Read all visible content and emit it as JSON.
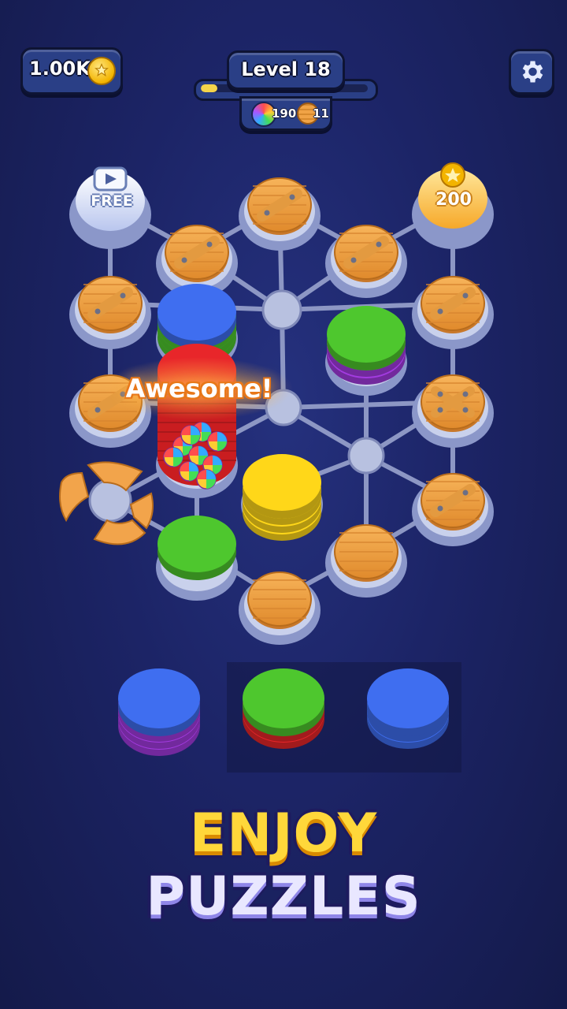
{
  "hud": {
    "coins": "1.00K",
    "level": "Level 18",
    "level_progress": 0.1,
    "rainbow_count": "190",
    "chip_count": "11"
  },
  "board": {
    "free_label": "FREE",
    "unlock_cost": "200",
    "combo_text": "Awesome!"
  },
  "tray": {
    "stacks": [
      {
        "top": "blue",
        "layers": [
          "purple",
          "purple",
          "purple"
        ]
      },
      {
        "top": "green",
        "layers": [
          "red",
          "red"
        ]
      },
      {
        "top": "blue",
        "layers": [
          "blue",
          "blue"
        ]
      }
    ]
  },
  "banner": {
    "line1": "ENJOY",
    "line2": "PUZZLES"
  },
  "colors": {
    "blue": "#3f6ef0",
    "green": "#4ec72e",
    "red": "#e8262a",
    "yellow": "#ffd719",
    "purple": "#a33be0",
    "wood": "#f0a346",
    "coin": "#f3b400"
  }
}
